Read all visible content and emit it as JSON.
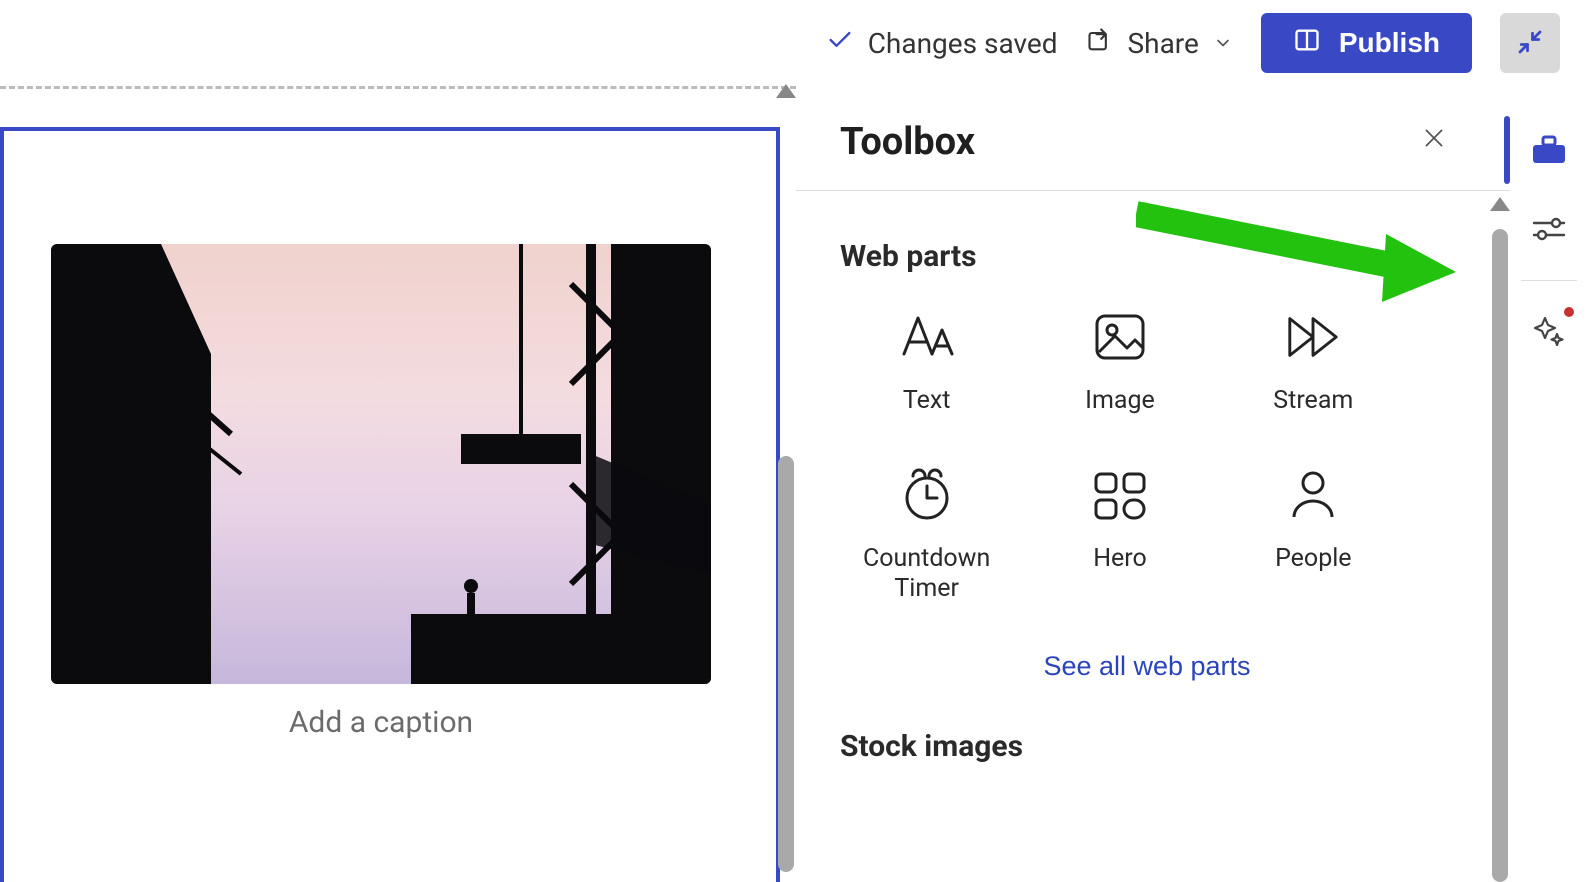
{
  "topbar": {
    "status_text": "Changes saved",
    "share_label": "Share",
    "publish_label": "Publish"
  },
  "canvas": {
    "caption_placeholder": "Add a caption"
  },
  "toolbox": {
    "title": "Toolbox",
    "sections": {
      "web_parts": {
        "heading": "Web parts",
        "items": [
          {
            "label": "Text",
            "icon": "text"
          },
          {
            "label": "Image",
            "icon": "image"
          },
          {
            "label": "Stream",
            "icon": "stream"
          },
          {
            "label": "Countdown Timer",
            "icon": "timer"
          },
          {
            "label": "Hero",
            "icon": "hero"
          },
          {
            "label": "People",
            "icon": "people"
          }
        ],
        "see_all_label": "See all web parts"
      },
      "stock_images": {
        "heading": "Stock images"
      }
    }
  },
  "side_rail": {
    "items": [
      {
        "name": "toolbox",
        "active": true
      },
      {
        "name": "settings",
        "active": false
      },
      {
        "name": "ai",
        "active": false,
        "notification": true
      }
    ]
  }
}
